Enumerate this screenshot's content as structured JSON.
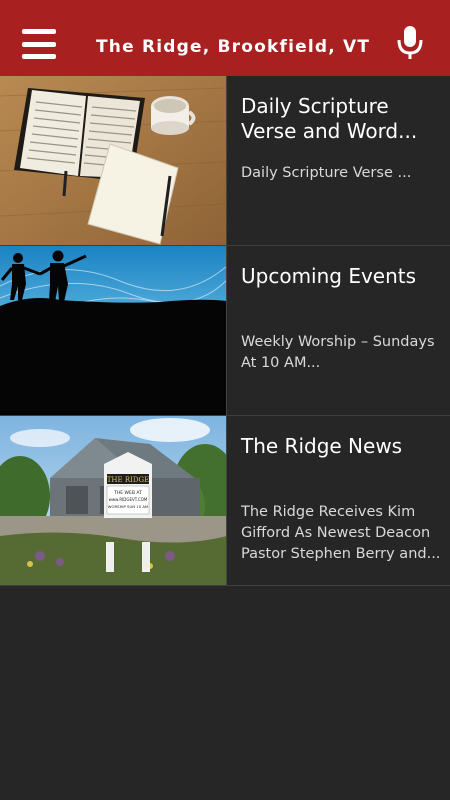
{
  "header": {
    "title": "The Ridge, Brookfield, VT",
    "menu_icon": "hamburger-menu-icon",
    "mic_icon": "microphone-icon",
    "bg_color": "#a8201f"
  },
  "feed": [
    {
      "title": "Daily Scripture Verse and Word...",
      "subtitle": "Daily Scripture Verse ...",
      "image": "open-bible-and-notebook"
    },
    {
      "title": "Upcoming Events",
      "subtitle": "Weekly Worship – Sundays At 10 AM...",
      "image": "silhouettes-on-hill"
    },
    {
      "title": "The Ridge News",
      "subtitle": "The Ridge Receives Kim Gifford As Newest Deacon Pastor Stephen Berry and...",
      "image": "church-barn-with-sign"
    }
  ],
  "sign_text": {
    "name": "THE RIDGE",
    "line1": "THE WEB AT",
    "line2": "www.RIDGEVT.COM",
    "line3": "WORSHIP SUN 10 AM"
  }
}
